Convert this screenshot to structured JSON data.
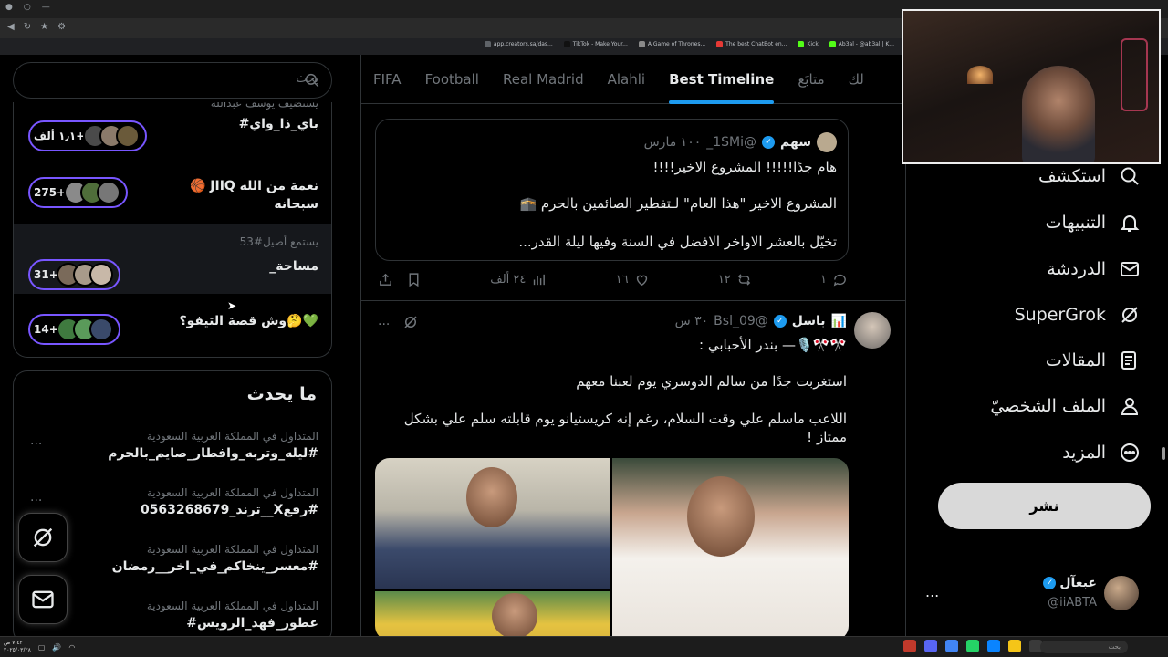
{
  "window": {
    "controls": [
      "●",
      "○",
      "—"
    ]
  },
  "bookmarks": [
    {
      "label": "app.creators.sa/das...",
      "color": "#5f6368"
    },
    {
      "label": "TikTok - Make Your...",
      "color": "#111111"
    },
    {
      "label": "A Game of Thrones...",
      "color": "#8a8a8a"
    },
    {
      "label": "The best ChatBot en...",
      "color": "#e53935"
    },
    {
      "label": "Kick",
      "color": "#53fc18"
    },
    {
      "label": "Ab3al - @ab3al | K...",
      "color": "#53fc18"
    }
  ],
  "nav": {
    "explore": "استكشف",
    "notifications": "التنبيهات",
    "chat": "الدردشة",
    "supergrok": "SuperGrok",
    "articles": "المقالات",
    "profile": "الملف الشخصيّ",
    "more": "المزيد",
    "post_button": "نشر"
  },
  "account": {
    "name": "عبعآل",
    "handle": "@iiABTA",
    "more": "..."
  },
  "tabs": [
    "FIFA",
    "Football",
    "Real Madrid",
    "Alahli",
    "Best Timeline",
    "متابَع",
    "لك"
  ],
  "quoted": {
    "name": "سهم",
    "handle": "@1SMi_",
    "time": "١٠٠ مارس",
    "line1": "هام جدًا!!!!! المشروع الاخير!!!!",
    "line2": "المشروع الاخير \"هذا العام\" لـتفطير الصائمين بالحرم 🕋",
    "line3": "تخيّل بالعشر الاواخر الافضل في السنة وفيها ليلة القدر..."
  },
  "actions": {
    "replies": "١",
    "reposts": "١٢",
    "likes": "١٦",
    "views": "٢٤ ألف"
  },
  "tweet2": {
    "name": "باسل",
    "handle": "@Bsl_09",
    "time": "٣٠ س",
    "bio_line": "🎌🎌🎙️— بندر الأحبابي :",
    "para1": "استغربت جدًا من سالم الدوسري يوم لعبنا معهم",
    "para2": "اللاعب ماسلم علي وقت السلام، رغم إنه كريستيانو يوم قابلته سلم علي بشكل ممتاز !",
    "more": "..."
  },
  "search": {
    "placeholder": "بحث"
  },
  "spaces": [
    {
      "host": "يستضيف يوسف عبدالله",
      "title": "باي_ذا_واي#",
      "count": "١٫١ ألف+"
    },
    {
      "host": "",
      "title": "نعمة من الله JIIQ 🏀 سبحانه",
      "count": "275+"
    },
    {
      "host": "يستمع أصيل#53",
      "title": "مساحة_",
      "count": "31+"
    },
    {
      "host": "",
      "title": "💚🤔وش قصة التيفو؟",
      "count": "14+"
    }
  ],
  "trends": {
    "title": "ما يحدث",
    "items": [
      {
        "context": "المتداول في المملكة العربية السعودية",
        "name": "#ليله_وتربه_وافطار_صايم_بالحرم"
      },
      {
        "context": "المتداول في المملكة العربية السعودية",
        "name": "#رفعX__ترند_0563268679"
      },
      {
        "context": "المتداول في المملكة العربية السعودية",
        "name": "#معسر_ينخاكم_في_اخر__رمضان"
      },
      {
        "context": "المتداول في المملكة العربية السعودية",
        "name": "عطور_فهد_الرويس#"
      }
    ],
    "more": "..."
  },
  "taskbar": {
    "time": "٧:٤٢ ص",
    "date": "٢٠٢٥/٠٣/٢٨",
    "search": "بحث"
  },
  "colors": {
    "accent": "#1d9bf0",
    "spaces_ring": "#7856ff",
    "background": "#000000"
  }
}
